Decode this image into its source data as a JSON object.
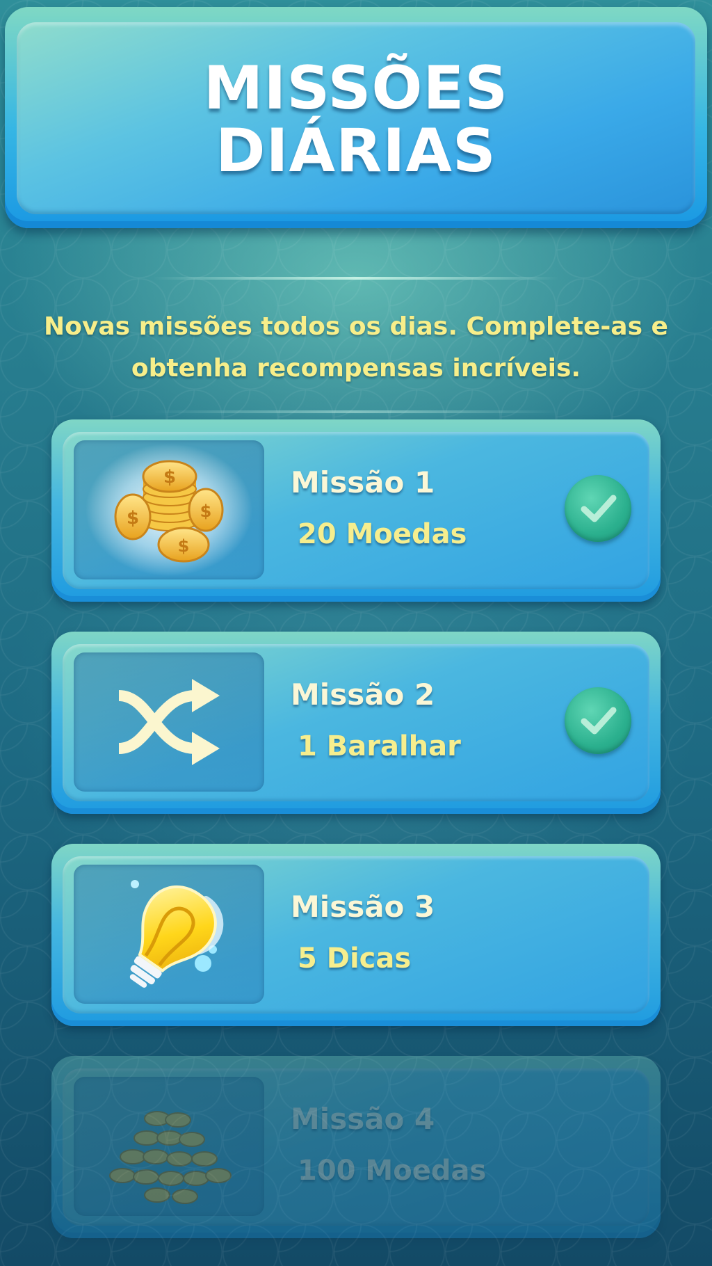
{
  "header": {
    "title_line1": "MISSÕES",
    "title_line2": "DIÁRIAS"
  },
  "subtitle": {
    "line1": "Novas missões todos os dias. Complete-as e",
    "line2": "obtenha recompensas incríveis."
  },
  "missions": [
    {
      "name": "Missão 1",
      "reward": "20 Moedas",
      "icon": "coins-icon",
      "completed": true,
      "locked": false
    },
    {
      "name": "Missão 2",
      "reward": "1 Baralhar",
      "icon": "shuffle-icon",
      "completed": true,
      "locked": false
    },
    {
      "name": "Missão 3",
      "reward": "5 Dicas",
      "icon": "lightbulb-icon",
      "completed": false,
      "locked": false
    },
    {
      "name": "Missão 4",
      "reward": "100 Moedas",
      "icon": "coin-pile-icon",
      "completed": false,
      "locked": true
    }
  ],
  "colors": {
    "title_text": "#ffffff",
    "subtitle_text": "#f7ee8a",
    "reward_text": "#f6ee8e",
    "card_blue": "#1f9be0",
    "check_green": "#2bb08e"
  }
}
